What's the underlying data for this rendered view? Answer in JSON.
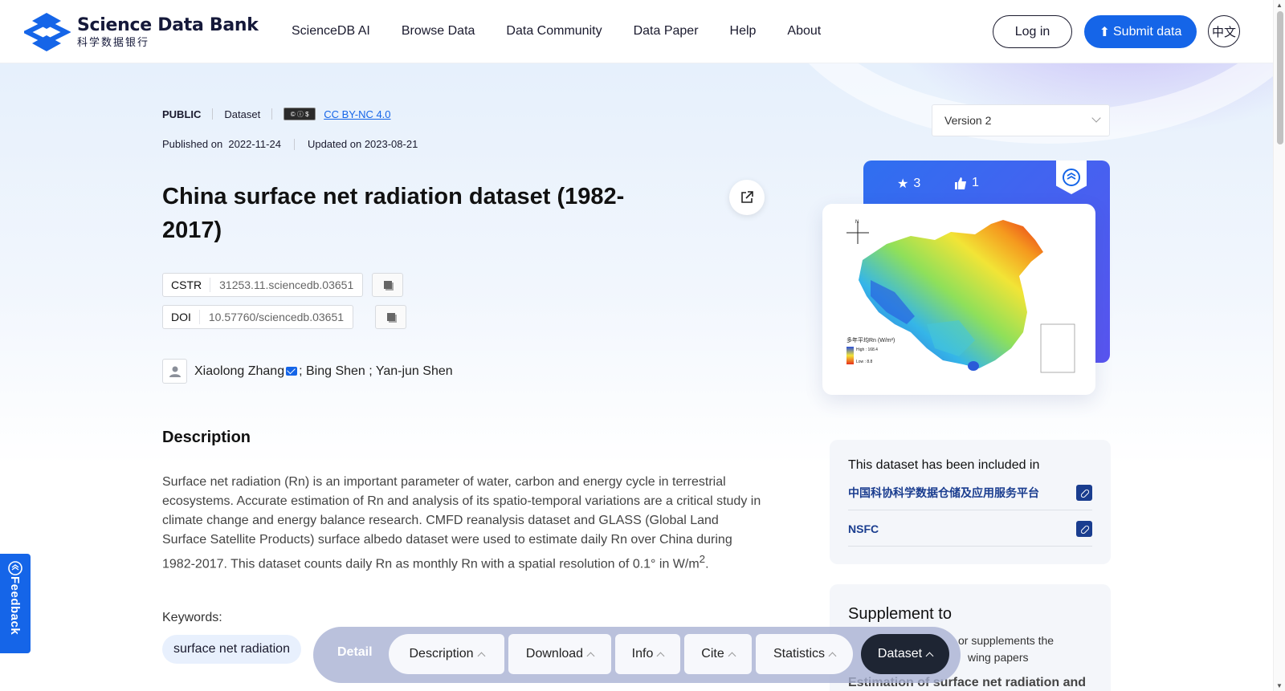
{
  "header": {
    "logo_en": "Science Data Bank",
    "logo_cn": "科学数据银行",
    "nav": [
      "ScienceDB AI",
      "Browse Data",
      "Data Community",
      "Data Paper",
      "Help",
      "About"
    ],
    "login_label": "Log in",
    "submit_label": "Submit data",
    "lang_label": "中文"
  },
  "meta": {
    "access": "PUBLIC",
    "type": "Dataset",
    "license": "CC BY-NC 4.0",
    "published_label": "Published on",
    "published_date": "2022-11-24",
    "updated_label": "Updated on",
    "updated_date": "2023-08-21"
  },
  "dataset": {
    "title": "China surface net radiation dataset (1982-2017)",
    "cstr_label": "CSTR",
    "cstr_value": "31253.11.sciencedb.03651",
    "doi_label": "DOI",
    "doi_value": "10.57760/sciencedb.03651",
    "author_primary": "Xiaolong Zhang",
    "authors_rest": "; Bing Shen ; Yan-jun Shen"
  },
  "description": {
    "heading": "Description",
    "text": "Surface net radiation (Rn) is an important parameter of water, carbon and energy cycle in terrestrial ecosystems. Accurate estimation of Rn and analysis of its spatio-temporal variations are a critical study in climate change and energy balance research. CMFD reanalysis dataset and GLASS (Global Land Surface Satellite Products) surface albedo dataset were used to estimate daily Rn over China during 1982-2017. This dataset counts daily Rn as monthly Rn with a spatial resolution of 0.1° in W/m",
    "superscript": "2",
    "suffix": ".",
    "keywords_label": "Keywords:",
    "keywords": [
      "surface net radiation"
    ]
  },
  "sidebar": {
    "version": "Version 2",
    "stars": "3",
    "likes": "1",
    "map_legend_title": "多年平均Rn (W/m²)",
    "map_legend_high": "High : 168.4",
    "map_legend_low": "Low : 8.8",
    "included_heading": "This dataset has been included in",
    "included": [
      "中国科协科学数据仓储及应用服务平台",
      "NSFC"
    ],
    "supplement_heading": "Supplement to",
    "supplement_sub1": "or supplements the",
    "supplement_sub2": "wing papers",
    "supplement_paper": "Estimation of surface net radiation and"
  },
  "feedback_label": "Feedback",
  "bottom_nav": {
    "detail": "Detail",
    "items": [
      "Description",
      "Download",
      "Info",
      "Cite",
      "Statistics"
    ],
    "active": "Dataset"
  },
  "colors": {
    "accent": "#1565e8",
    "dark": "#1e2533",
    "link": "#1a3d8f"
  }
}
